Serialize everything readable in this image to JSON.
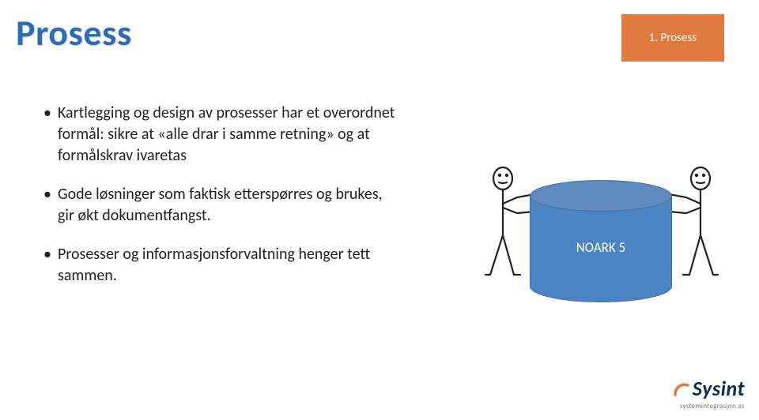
{
  "title": "Prosess",
  "tag": "1. Prosess",
  "bullets": [
    "Kartlegging og design av prosesser har et overordnet formål: sikre at «alle drar i samme retning» og at formålskrav ivaretas",
    "Gode løsninger som faktisk etterspørres og brukes, gir økt dokumentfangst.",
    "Prosesser og informasjonsforvaltning henger tett sammen."
  ],
  "diagram": {
    "cylinder_label": "NOARK 5"
  },
  "logo": {
    "brand": "Sysint",
    "sub": "systemintegrasjon.as"
  }
}
